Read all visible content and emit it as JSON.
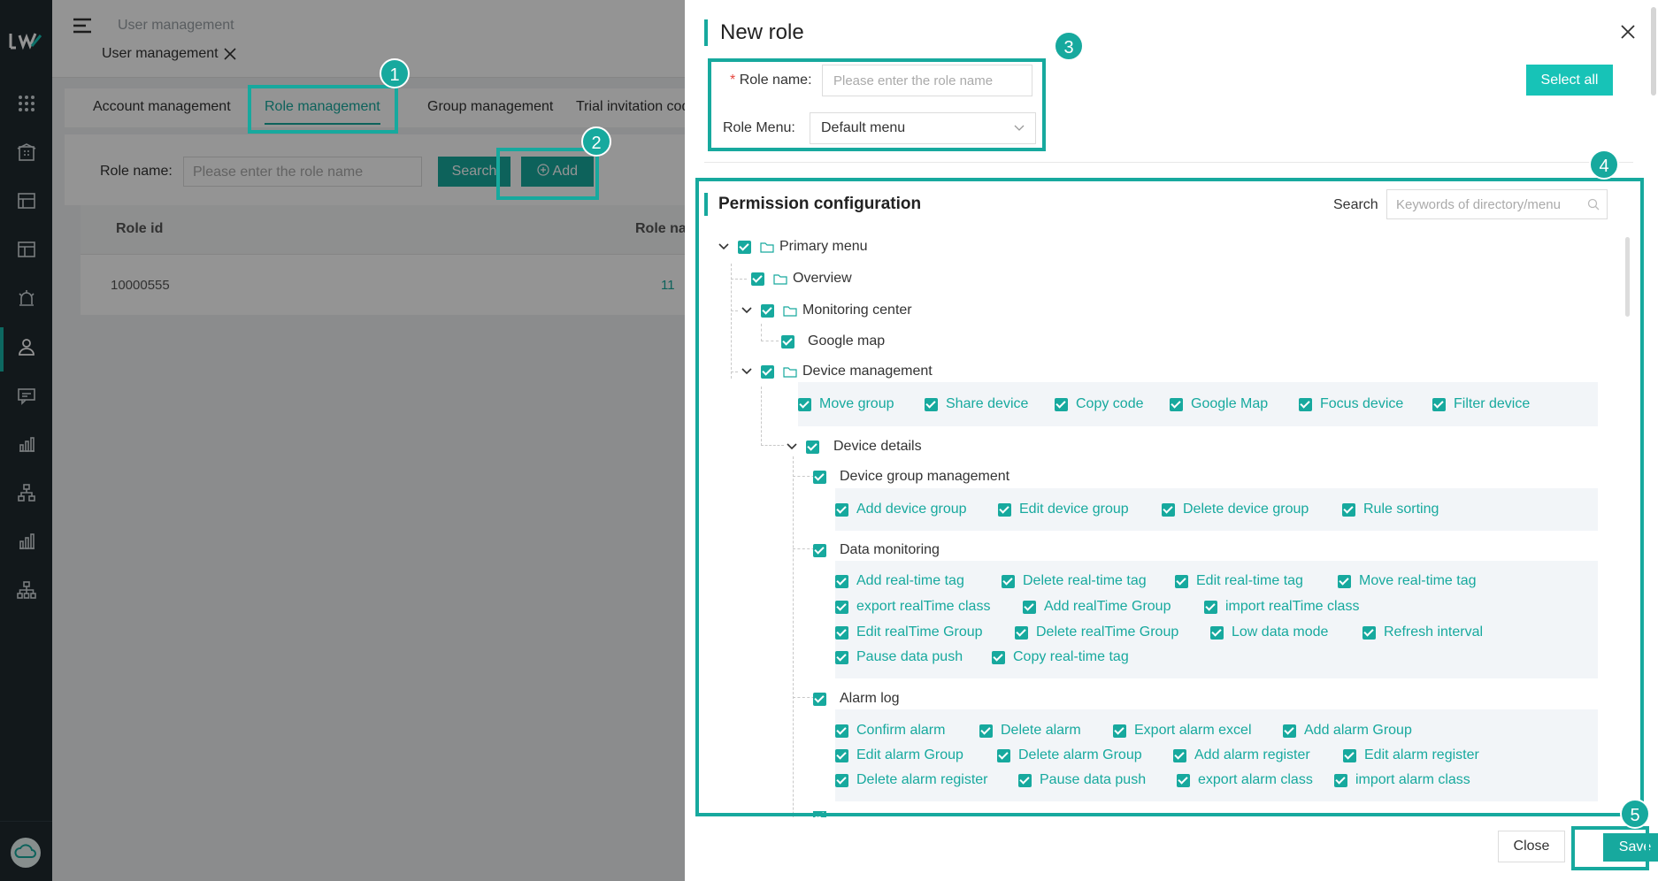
{
  "page": {
    "breadcrumb_title": "User management",
    "breadcrumb_tag": "User management",
    "tabs": [
      "Account management",
      "Role management",
      "Group management",
      "Trial invitation cod"
    ],
    "filter": {
      "label": "Role name:",
      "placeholder": "Please enter the role name",
      "search_label": "Search",
      "add_label": "Add"
    },
    "table": {
      "headers": [
        "Role id",
        "Role na"
      ],
      "rows": [
        {
          "id": "10000555",
          "count": "11"
        }
      ]
    }
  },
  "drawer": {
    "title": "New role",
    "role_name_label": "Role name:",
    "role_name_required": "*",
    "role_name_placeholder": "Please enter the role name",
    "role_menu_label": "Role Menu:",
    "role_menu_value": "Default menu",
    "select_all_label": "Select all",
    "permission_title": "Permission configuration",
    "search_label": "Search",
    "search_placeholder": "Keywords of directory/menu",
    "close_label": "Close",
    "save_label": "Save"
  },
  "tree": {
    "primary_menu": "Primary menu",
    "overview": "Overview",
    "monitoring_center": "Monitoring center",
    "google_map": "Google map",
    "device_management": "Device management",
    "device_management_perms": [
      "Move group",
      "Share device",
      "Copy code",
      "Google Map",
      "Focus device",
      "Filter device"
    ],
    "device_details": "Device details",
    "device_group_management": "Device group management",
    "device_group_perms": [
      "Add device group",
      "Edit device group",
      "Delete device group",
      "Rule sorting"
    ],
    "data_monitoring": "Data monitoring",
    "data_monitoring_perms": [
      "Add real-time tag",
      "Delete real-time tag",
      "Edit real-time tag",
      "Move real-time tag",
      "export realTime class",
      "Add realTime Group",
      "import realTime class",
      "Edit realTime Group",
      "Delete realTime Group",
      "Low data mode",
      "Refresh interval",
      "Pause data push",
      "Copy real-time tag"
    ],
    "alarm_log": "Alarm log",
    "alarm_log_perms": [
      "Confirm alarm",
      "Delete alarm",
      "Export alarm excel",
      "Add alarm Group",
      "Edit alarm Group",
      "Delete alarm Group",
      "Add alarm register",
      "Edit alarm register",
      "Delete alarm register",
      "Pause data push",
      "export alarm class",
      "import alarm class"
    ]
  },
  "callouts": [
    "1",
    "2",
    "3",
    "4",
    "5"
  ],
  "colors": {
    "accent": "#17a99e",
    "rail": "#1f2a30",
    "select_all": "#17c3b7"
  }
}
